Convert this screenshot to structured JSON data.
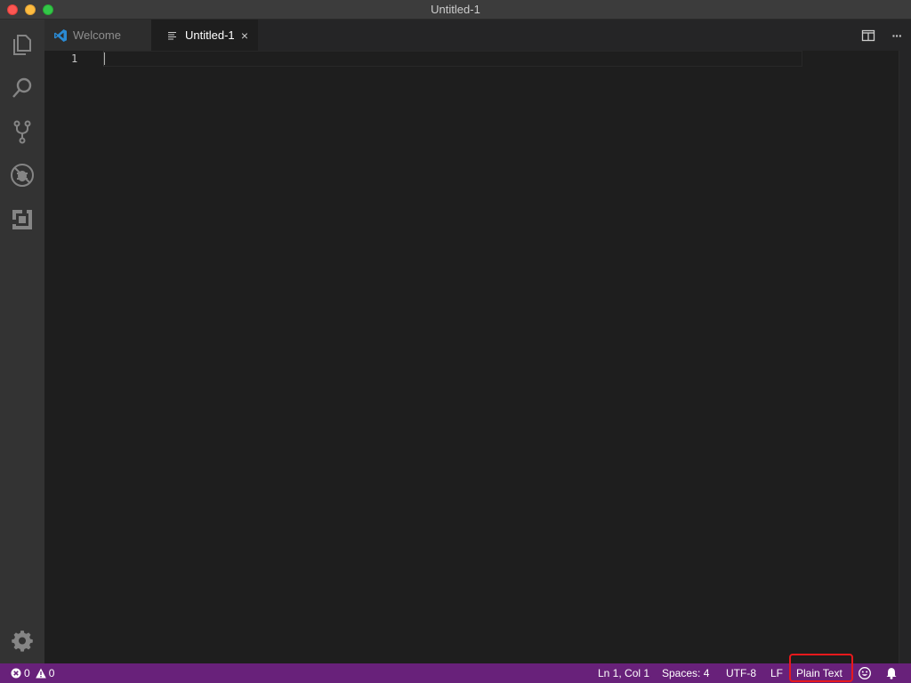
{
  "window": {
    "title": "Untitled-1"
  },
  "activity_bar": {
    "items": [
      {
        "icon": "files-icon"
      },
      {
        "icon": "search-icon"
      },
      {
        "icon": "source-control-icon"
      },
      {
        "icon": "debug-icon"
      },
      {
        "icon": "extensions-icon"
      }
    ],
    "settings_icon": "gear-icon"
  },
  "tabs": [
    {
      "label": "Welcome",
      "icon": "vscode-logo-icon",
      "active": false
    },
    {
      "label": "Untitled-1",
      "icon": "text-file-icon",
      "active": true,
      "close": "×"
    }
  ],
  "tab_actions": [
    {
      "icon": "split-editor-icon"
    },
    {
      "icon": "more-actions-icon",
      "label": "···"
    }
  ],
  "editor": {
    "line_numbers": [
      "1"
    ]
  },
  "status_bar": {
    "errors": "0",
    "warnings": "0",
    "cursor_position": "Ln 1, Col 1",
    "indentation": "Spaces: 4",
    "encoding": "UTF-8",
    "line_ending": "LF",
    "language_mode": "Plain Text",
    "feedback_icon": "smiley-icon",
    "notifications_icon": "bell-icon"
  },
  "colors": {
    "status_bar": "#68217a",
    "highlight": "#e8191c",
    "editor_bg": "#1e1e1e",
    "activity_bar": "#333333"
  }
}
